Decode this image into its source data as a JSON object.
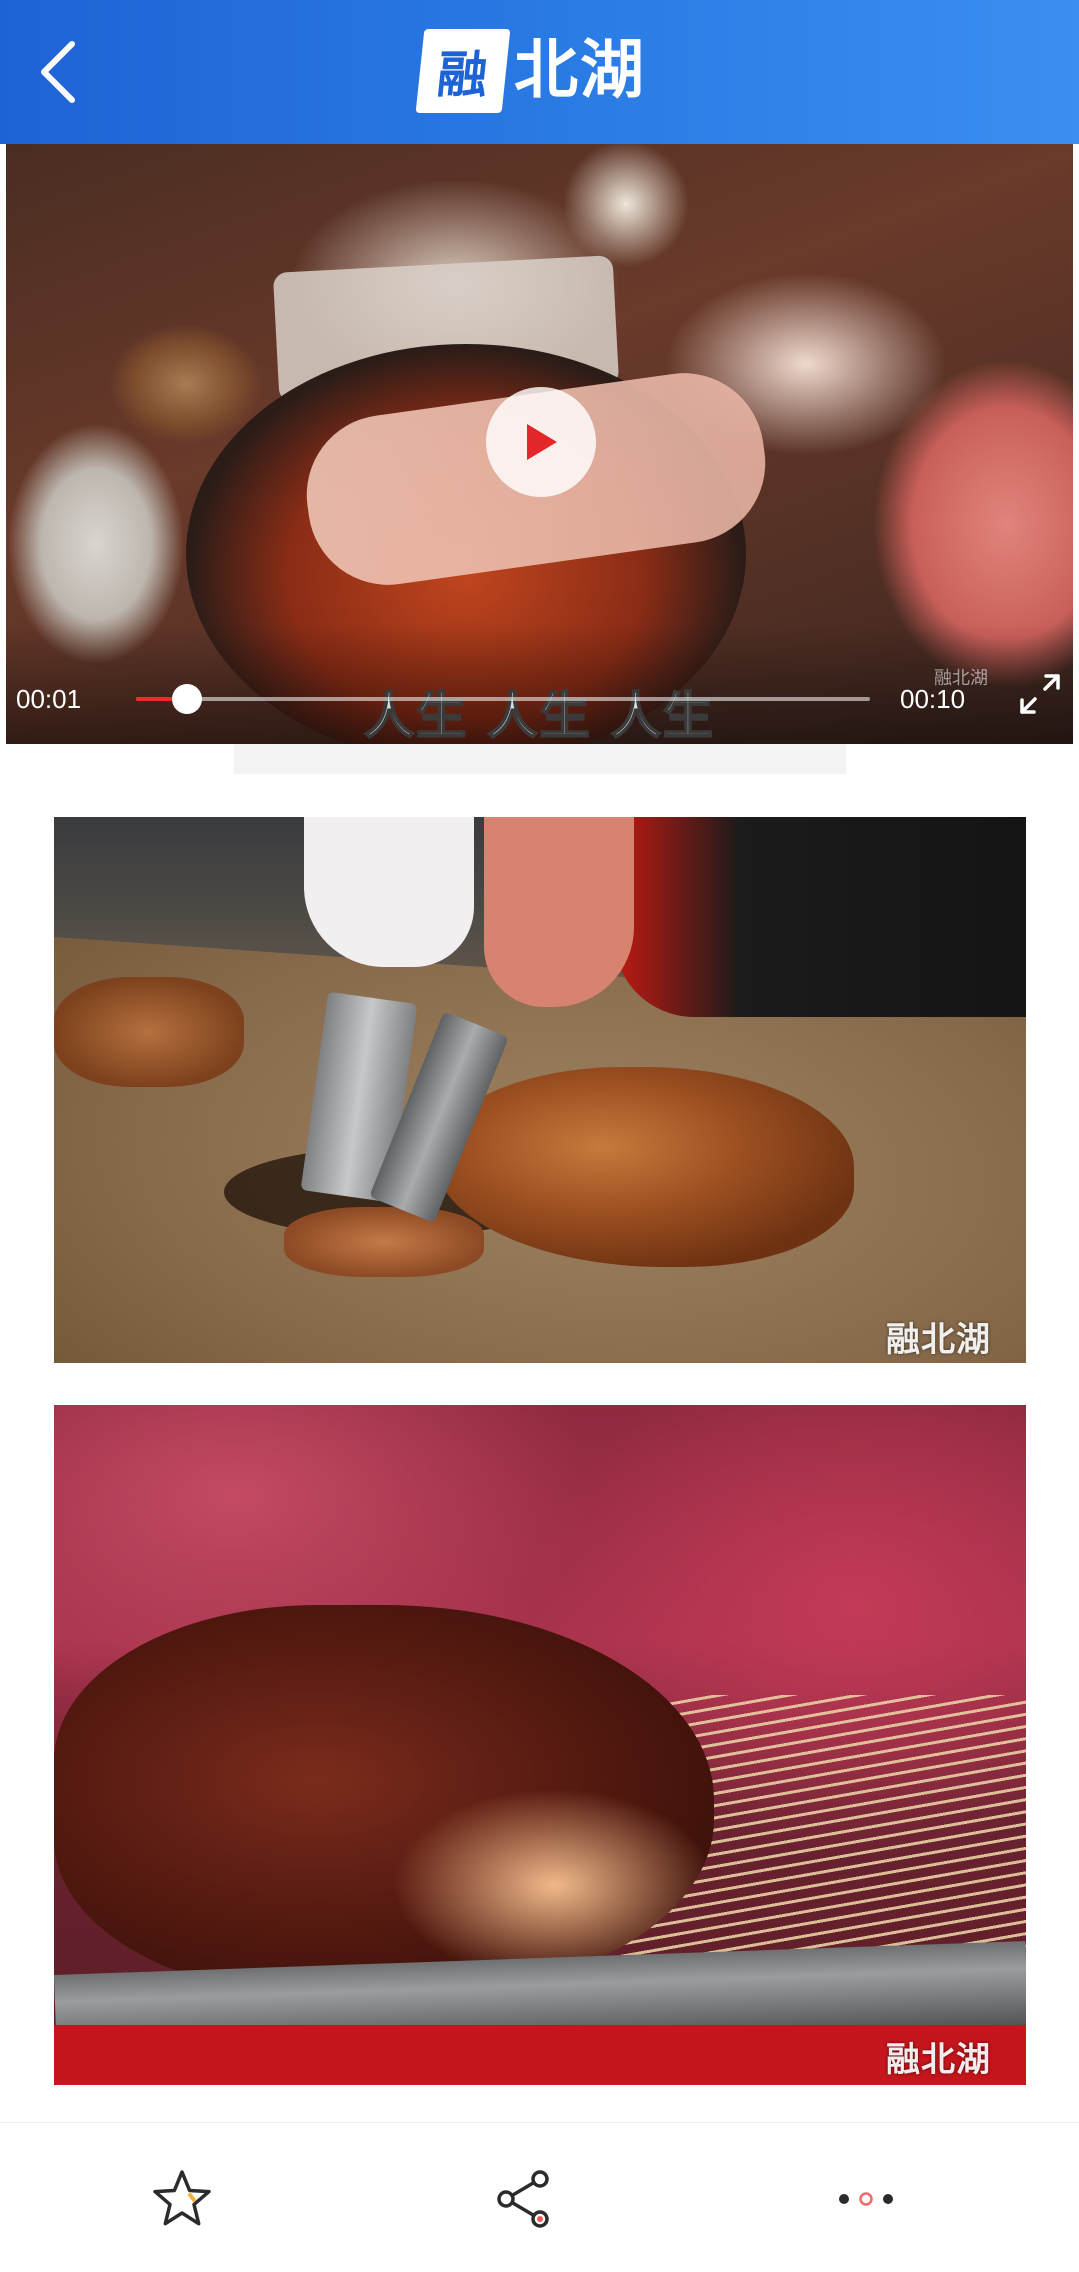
{
  "header": {
    "logo_box": "融",
    "logo_text": "北湖",
    "back_icon": "chevron-left-icon",
    "colors": {
      "start": "#1e63d6",
      "end": "#3a8ff0"
    }
  },
  "video": {
    "current_time": "00:01",
    "total_time": "00:10",
    "progress": 0.07,
    "subtitle": "人生 人生 人生",
    "watermark": "融北湖",
    "play_icon": "play-icon",
    "fullscreen_icon": "fullscreen-icon",
    "accent_color": "#ee2a2a"
  },
  "images": [
    {
      "watermark": "融北湖"
    },
    {
      "watermark": "融北湖"
    }
  ],
  "bottom_bar": {
    "favorite_icon": "star-icon",
    "share_icon": "share-icon",
    "more_icon": "more-icon"
  }
}
